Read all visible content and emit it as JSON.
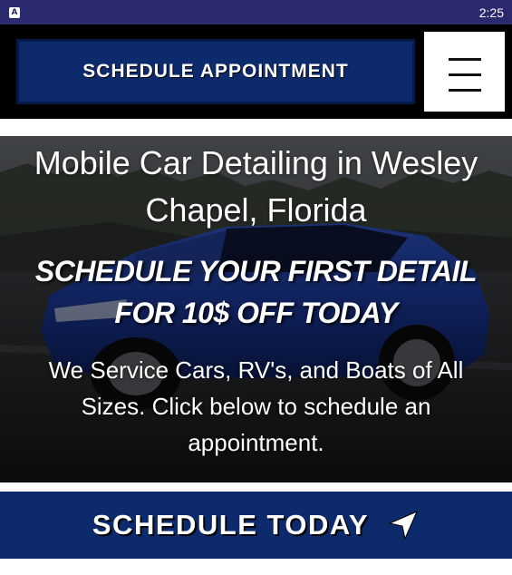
{
  "status_bar": {
    "app_icon_letter": "A",
    "time": "2:25"
  },
  "header": {
    "appointment_button_label": "SCHEDULE APPOINTMENT",
    "menu_icon": "hamburger-menu-icon"
  },
  "hero": {
    "title": "Mobile Car Detailing in Wesley Chapel, Florida",
    "promo": "SCHEDULE YOUR FIRST DETAIL FOR 10$ OFF TODAY",
    "description": "We Service Cars, RV's, and Boats of All Sizes. Click below to schedule an appointment."
  },
  "cta": {
    "label": "SCHEDULE TODAY",
    "icon": "navigation-arrow-icon"
  },
  "colors": {
    "status_bar": "#2b2a6e",
    "brand_blue": "#0d2a6c",
    "header_bg": "#000000"
  }
}
